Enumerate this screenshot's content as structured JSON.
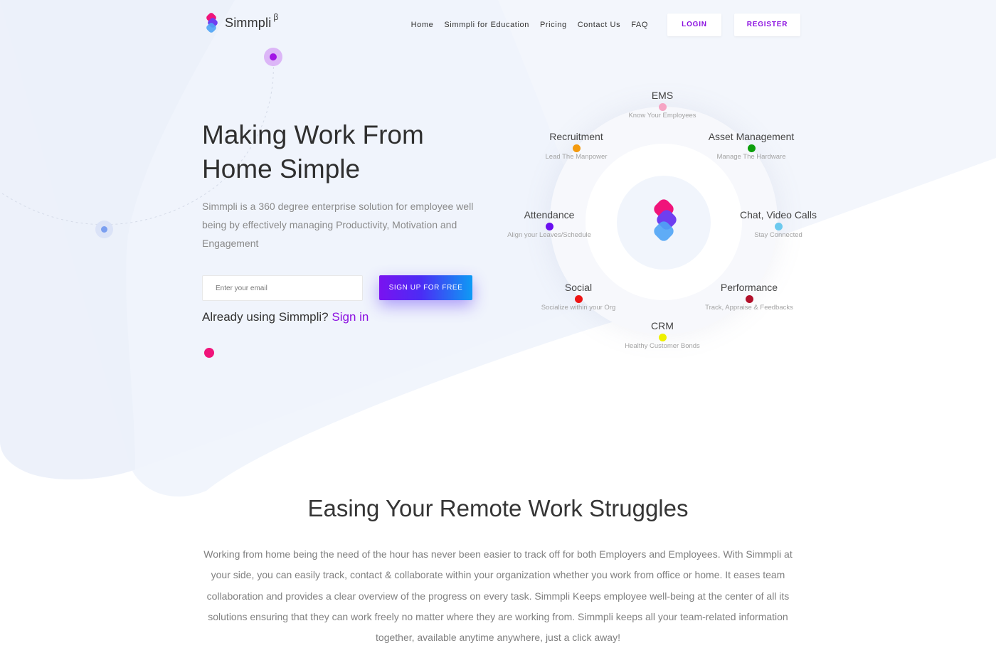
{
  "brand": {
    "name": "Simmpli",
    "badge": "β",
    "colors": {
      "primary_purple": "#8b10e0",
      "pink": "#f0147a",
      "blue": "#4f8ff0"
    }
  },
  "nav": {
    "links": [
      "Home",
      "Simmpli for Education",
      "Pricing",
      "Contact Us",
      "FAQ"
    ],
    "login_label": "LOGIN",
    "register_label": "REGISTER"
  },
  "hero": {
    "title": "Making Work From Home Simple",
    "subtitle": "Simmpli is a 360 degree enterprise solution for employee well being by effectively managing Productivity, Motivation and Engagement",
    "email_placeholder": "Enter your email",
    "signup_label": "SIGN UP FOR FREE",
    "signin_prompt": "Already using Simmpli?",
    "signin_link": "Sign in"
  },
  "features": [
    {
      "name": "EMS",
      "tagline": "Know Your Employees",
      "color": "#f6a5c4",
      "icon": "pink-dot"
    },
    {
      "name": "Recruitment",
      "tagline": "Lead The Manpower",
      "color": "#f39a0f",
      "icon": "orange-dot"
    },
    {
      "name": "Asset Management",
      "tagline": "Manage The Hardware",
      "color": "#0c9e0c",
      "icon": "green-dot"
    },
    {
      "name": "Attendance",
      "tagline": "Align your Leaves/Schedule",
      "color": "#6a0ff0",
      "icon": "purple-dot"
    },
    {
      "name": "Chat, Video Calls",
      "tagline": "Stay Connected",
      "color": "#6cc9ee",
      "icon": "lightblue-dot"
    },
    {
      "name": "Social",
      "tagline": "Socialize within your Org",
      "color": "#ee1414",
      "icon": "red-dot"
    },
    {
      "name": "Performance",
      "tagline": "Track, Appraise & Feedbacks",
      "color": "#b2102a",
      "icon": "crimson-dot"
    },
    {
      "name": "CRM",
      "tagline": "Healthy Customer Bonds",
      "color": "#eef000",
      "icon": "yellow-dot"
    }
  ],
  "about": {
    "title": "Easing Your Remote Work Struggles",
    "text": "Working from home being the need of the hour has never been easier to track off for both Employers and Employees. With Simmpli at your side, you can easily track, contact & collaborate within your organization whether you work from office or home. It eases team collaboration and provides a clear overview of the progress on every task. Simmpli Keeps employee well-being at the center of all its solutions ensuring that they can work freely no matter where they are working from. Simmpli keeps all your team-related information together, available anytime anywhere, just a click away!"
  }
}
